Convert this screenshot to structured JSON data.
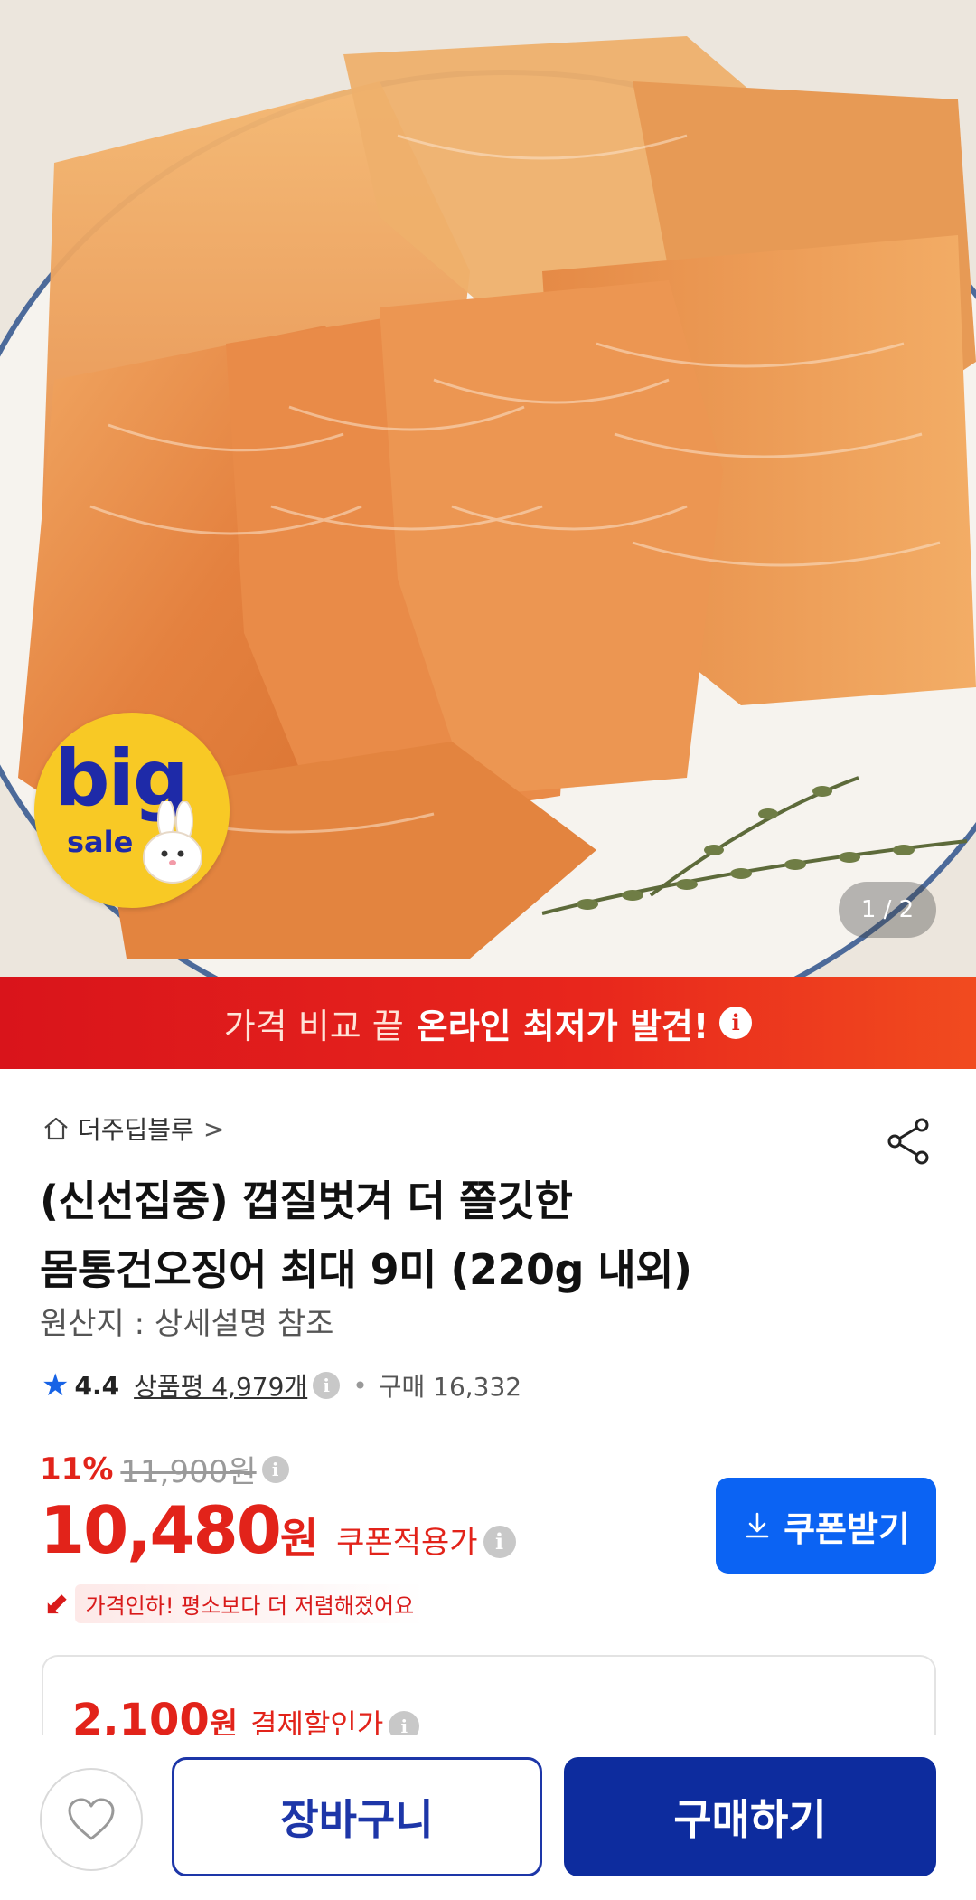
{
  "hero": {
    "page_indicator": "1 / 2",
    "badge_big": "big",
    "badge_sale": "sale"
  },
  "banner": {
    "text_light": "가격 비교 끝",
    "text_strong": "온라인 최저가 발견!",
    "info_glyph": "i"
  },
  "product": {
    "store_name": "더주딥블루",
    "store_chevron": ">",
    "title_line1": "(신선집중) 껍질벗겨 더 쫄깃한",
    "title_line2": "몸통건오징어 최대 9미 (220g 내외)",
    "origin": "원산지 : 상세설명 참조",
    "rating": "4.4",
    "reviews_label": "상품평 4,979개",
    "purchase_label": "구매 16,332",
    "discount_percent": "11%",
    "original_price": "11,900원",
    "price": "10,480",
    "price_unit": "원",
    "coupon_note": "쿠폰적용가",
    "coupon_button": "쿠폰받기",
    "price_drop_text": "가격인하! 평소보다 더 저렴해졌어요",
    "payment_amount": "2,100",
    "payment_unit": "원",
    "payment_label": "결제할인가"
  },
  "bottom_bar": {
    "cart_label": "장바구니",
    "buy_label": "구매하기"
  },
  "colors": {
    "sale_red": "#e2231a",
    "coupon_blue": "#0b63f3",
    "buy_navy": "#0d2c9e",
    "star_blue": "#1763e6"
  },
  "icons": [
    "home-icon",
    "share-icon",
    "star-icon",
    "info-icon",
    "download-icon",
    "price-down-arrow-icon",
    "heart-icon"
  ]
}
